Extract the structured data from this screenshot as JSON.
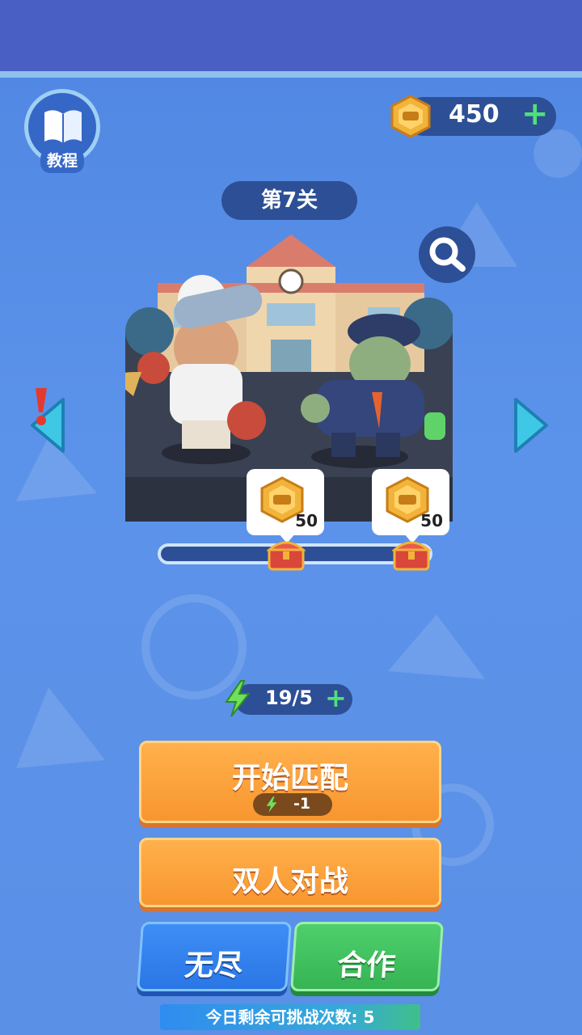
{
  "tutorial": {
    "label": "教程",
    "icon": "book-icon"
  },
  "currency": {
    "coins": "450",
    "plus": "+",
    "icon": "coin-icon"
  },
  "level": {
    "title": "第7关"
  },
  "search": {
    "icon": "magnifier-icon"
  },
  "rewards": [
    {
      "amount": "50",
      "icon": "coin-icon"
    },
    {
      "amount": "50",
      "icon": "coin-icon"
    }
  ],
  "progress": {
    "fraction": 0.0
  },
  "energy": {
    "value": "19/5",
    "plus": "+",
    "icon": "lightning-icon"
  },
  "buttons": {
    "match": {
      "label": "开始匹配",
      "cost": "-1"
    },
    "duel": {
      "label": "双人对战"
    },
    "endless": {
      "label": "无尽"
    },
    "coop": {
      "label": "合作"
    }
  },
  "remaining": {
    "text": "今日剩余可挑战次数: 5"
  },
  "colors": {
    "background": "#5a90e6",
    "orange_button": "#f8962f",
    "blue_button": "#2a76e6",
    "green_button": "#36b454",
    "pill": "#2d4f96",
    "accent_plus": "#4fe07a"
  }
}
